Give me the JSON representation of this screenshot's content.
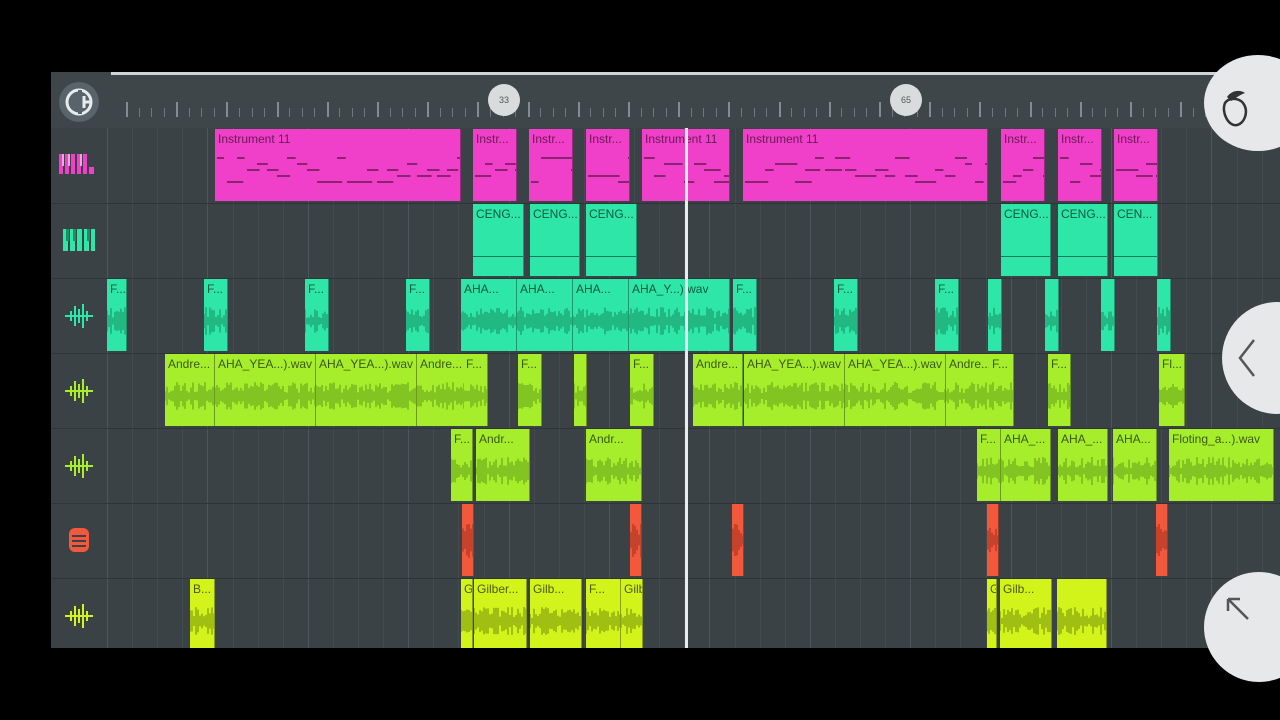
{
  "ruler": {
    "markers": [
      "33",
      "65"
    ]
  },
  "tracks": [
    {
      "icon": "piano-roll-icon"
    },
    {
      "icon": "keyboard-icon"
    },
    {
      "icon": "audio-wave-icon"
    },
    {
      "icon": "audio-wave-icon"
    },
    {
      "icon": "audio-wave-icon"
    },
    {
      "icon": "microphone-icon"
    },
    {
      "icon": "audio-wave-icon"
    }
  ],
  "clips": [
    {
      "track": 0,
      "label": "Instrument 11",
      "color": "pink"
    },
    {
      "track": 0,
      "label": "Instr...",
      "color": "pink"
    },
    {
      "track": 0,
      "label": "Instr...",
      "color": "pink"
    },
    {
      "track": 0,
      "label": "Instr...",
      "color": "pink"
    },
    {
      "track": 0,
      "label": "Instrument 11",
      "color": "pink"
    },
    {
      "track": 0,
      "label": "Instrument 11",
      "color": "pink"
    },
    {
      "track": 0,
      "label": "Instr...",
      "color": "pink"
    },
    {
      "track": 0,
      "label": "Instr...",
      "color": "pink"
    },
    {
      "track": 0,
      "label": "Instr...",
      "color": "pink"
    },
    {
      "track": 1,
      "label": "CENG...",
      "color": "teal"
    },
    {
      "track": 1,
      "label": "CENG...",
      "color": "teal"
    },
    {
      "track": 1,
      "label": "CENG...",
      "color": "teal"
    },
    {
      "track": 1,
      "label": "CENG...",
      "color": "teal"
    },
    {
      "track": 1,
      "label": "CENG...",
      "color": "teal"
    },
    {
      "track": 1,
      "label": "CEN...",
      "color": "teal"
    },
    {
      "track": 2,
      "label": "F...",
      "color": "teal"
    },
    {
      "track": 2,
      "label": "F...",
      "color": "teal"
    },
    {
      "track": 2,
      "label": "F...",
      "color": "teal"
    },
    {
      "track": 2,
      "label": "F...",
      "color": "teal"
    },
    {
      "track": 2,
      "label": "AHA...",
      "color": "teal"
    },
    {
      "track": 2,
      "label": "AHA...",
      "color": "teal"
    },
    {
      "track": 2,
      "label": "AHA...",
      "color": "teal"
    },
    {
      "track": 2,
      "label": "AHA_Y...).wav",
      "color": "teal"
    },
    {
      "track": 2,
      "label": "F...",
      "color": "teal"
    },
    {
      "track": 2,
      "label": "F...",
      "color": "teal"
    },
    {
      "track": 2,
      "label": "F...",
      "color": "teal"
    },
    {
      "track": 2,
      "label": "",
      "color": "teal"
    },
    {
      "track": 2,
      "label": "",
      "color": "teal"
    },
    {
      "track": 2,
      "label": "",
      "color": "teal"
    },
    {
      "track": 2,
      "label": "",
      "color": "teal"
    },
    {
      "track": 3,
      "label": "Andre...",
      "color": "lime"
    },
    {
      "track": 3,
      "label": "AHA_YEA...).wav",
      "color": "lime"
    },
    {
      "track": 3,
      "label": "AHA_YEA...).wav",
      "color": "lime"
    },
    {
      "track": 3,
      "label": "Andre...",
      "color": "lime"
    },
    {
      "track": 3,
      "label": "F...",
      "color": "lime"
    },
    {
      "track": 3,
      "label": "F...",
      "color": "lime"
    },
    {
      "track": 3,
      "label": "",
      "color": "lime"
    },
    {
      "track": 3,
      "label": "F...",
      "color": "lime"
    },
    {
      "track": 3,
      "label": "Andre...",
      "color": "lime"
    },
    {
      "track": 3,
      "label": "AHA_YEA...).wav",
      "color": "lime"
    },
    {
      "track": 3,
      "label": "AHA_YEA...).wav",
      "color": "lime"
    },
    {
      "track": 3,
      "label": "Andre...",
      "color": "lime"
    },
    {
      "track": 3,
      "label": "F...",
      "color": "lime"
    },
    {
      "track": 3,
      "label": "F...",
      "color": "lime"
    },
    {
      "track": 3,
      "label": "Fl...",
      "color": "lime"
    },
    {
      "track": 4,
      "label": "F...",
      "color": "lime"
    },
    {
      "track": 4,
      "label": "Andr...",
      "color": "lime"
    },
    {
      "track": 4,
      "label": "Andr...",
      "color": "lime"
    },
    {
      "track": 4,
      "label": "F...",
      "color": "lime"
    },
    {
      "track": 4,
      "label": "AHA_...",
      "color": "lime"
    },
    {
      "track": 4,
      "label": "AHA_...",
      "color": "lime"
    },
    {
      "track": 4,
      "label": "AHA...",
      "color": "lime"
    },
    {
      "track": 4,
      "label": "Floting_a...).wav",
      "color": "lime"
    },
    {
      "track": 5,
      "label": "",
      "color": "red"
    },
    {
      "track": 5,
      "label": "",
      "color": "red"
    },
    {
      "track": 5,
      "label": "",
      "color": "red"
    },
    {
      "track": 5,
      "label": "",
      "color": "red"
    },
    {
      "track": 5,
      "label": "",
      "color": "red"
    },
    {
      "track": 6,
      "label": "B...",
      "color": "yel"
    },
    {
      "track": 6,
      "label": "Gilber...",
      "color": "yel"
    },
    {
      "track": 6,
      "label": "Gilber...",
      "color": "yel"
    },
    {
      "track": 6,
      "label": "Gilb...",
      "color": "yel"
    },
    {
      "track": 6,
      "label": "F...",
      "color": "yel"
    },
    {
      "track": 6,
      "label": "Gilber...",
      "color": "yel"
    },
    {
      "track": 6,
      "label": "Gilber...",
      "color": "yel"
    },
    {
      "track": 6,
      "label": "Gilb...",
      "color": "yel"
    },
    {
      "track": 6,
      "label": "",
      "color": "yel"
    }
  ],
  "buttons": {
    "menu": "fruit-logo-icon",
    "back": "chevron-left-icon",
    "collapse": "arrow-up-left-icon",
    "app": "app-logo-icon"
  }
}
